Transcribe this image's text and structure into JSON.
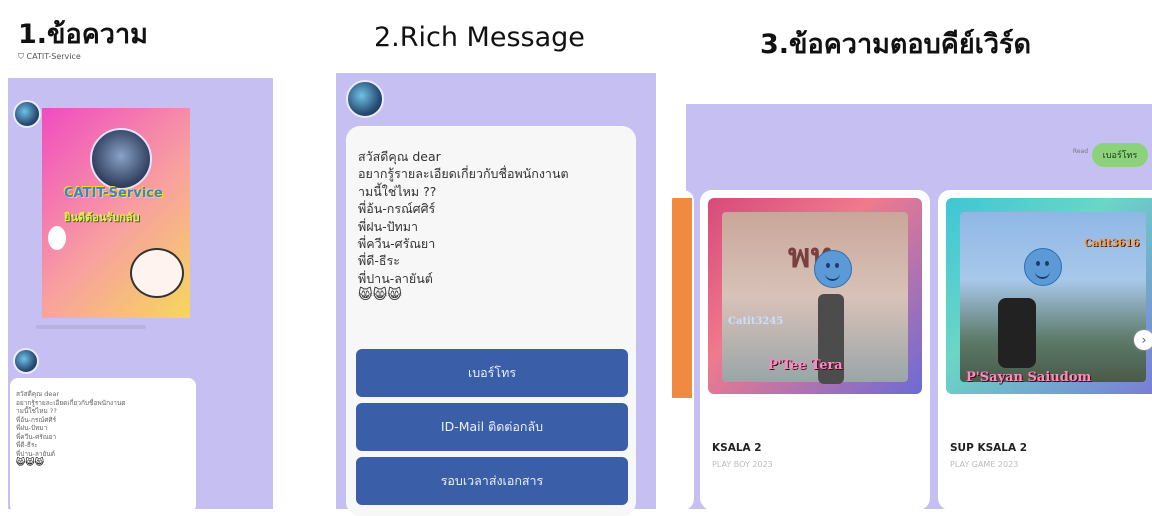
{
  "titles": {
    "t1": "1.ข้อความ",
    "t2": "2.Rich Message",
    "t3": "3.ข้อความตอบคีย์เวิร์ด"
  },
  "panel1": {
    "header": "CATIT-Service",
    "banner_line1": "CATIT-Service",
    "banner_line2": "ยินดีต้อนรับกลับ",
    "message_lines": [
      "สวัสดีคุณ dear",
      "อยากรู้รายละเอียดเกี่ยวกับชื่อพนักงานต",
      "ามนี้ใช่ไหม ??",
      "พี่อ้น-กรณ์ศศิร์",
      "พี่ฝน-ปัทมา",
      "พี่ควีน-ศรัณยา",
      "พี่ดี-ธีระ",
      "พี่ปาน-ลายันต์"
    ],
    "emoji": "😸😸😸"
  },
  "panel2": {
    "message_lines": [
      "สวัสดีคุณ dear",
      "อยากรู้รายละเอียดเกี่ยวกับชื่อพนักงานต",
      "ามนี้ใช่ไหม ??",
      "พี่อ้น-กรณ์ศศิร์",
      "พี่ฝน-ปัทมา",
      "พี่ควีน-ศรัณยา",
      "พี่ดี-ธีระ",
      "พี่ปาน-ลายันต์"
    ],
    "emoji": "😸😸😸",
    "buttons": [
      "เบอร์โทร",
      "ID-Mail ติดต่อกลับ",
      "รอบเวลาส่งเอกสาร"
    ]
  },
  "panel3": {
    "reply": "เบอร์โทร",
    "read_label": "Read",
    "cards": [
      {
        "title": "KSALA 2",
        "subtitle": "PLAY BOY 2023",
        "photo_sign": "พท",
        "photo_tag": "Catit3245",
        "caption": "P'Tee Tera"
      },
      {
        "title": "SUP KSALA 2",
        "subtitle": "PLAY GAME 2023",
        "photo_tag": "Catit3616",
        "caption": "P'Sayan Saiudom"
      }
    ]
  },
  "colors": {
    "panel_bg": "#c6c0f2",
    "button_bg": "#3b5ea8",
    "reply_pill": "#8bd27a"
  }
}
